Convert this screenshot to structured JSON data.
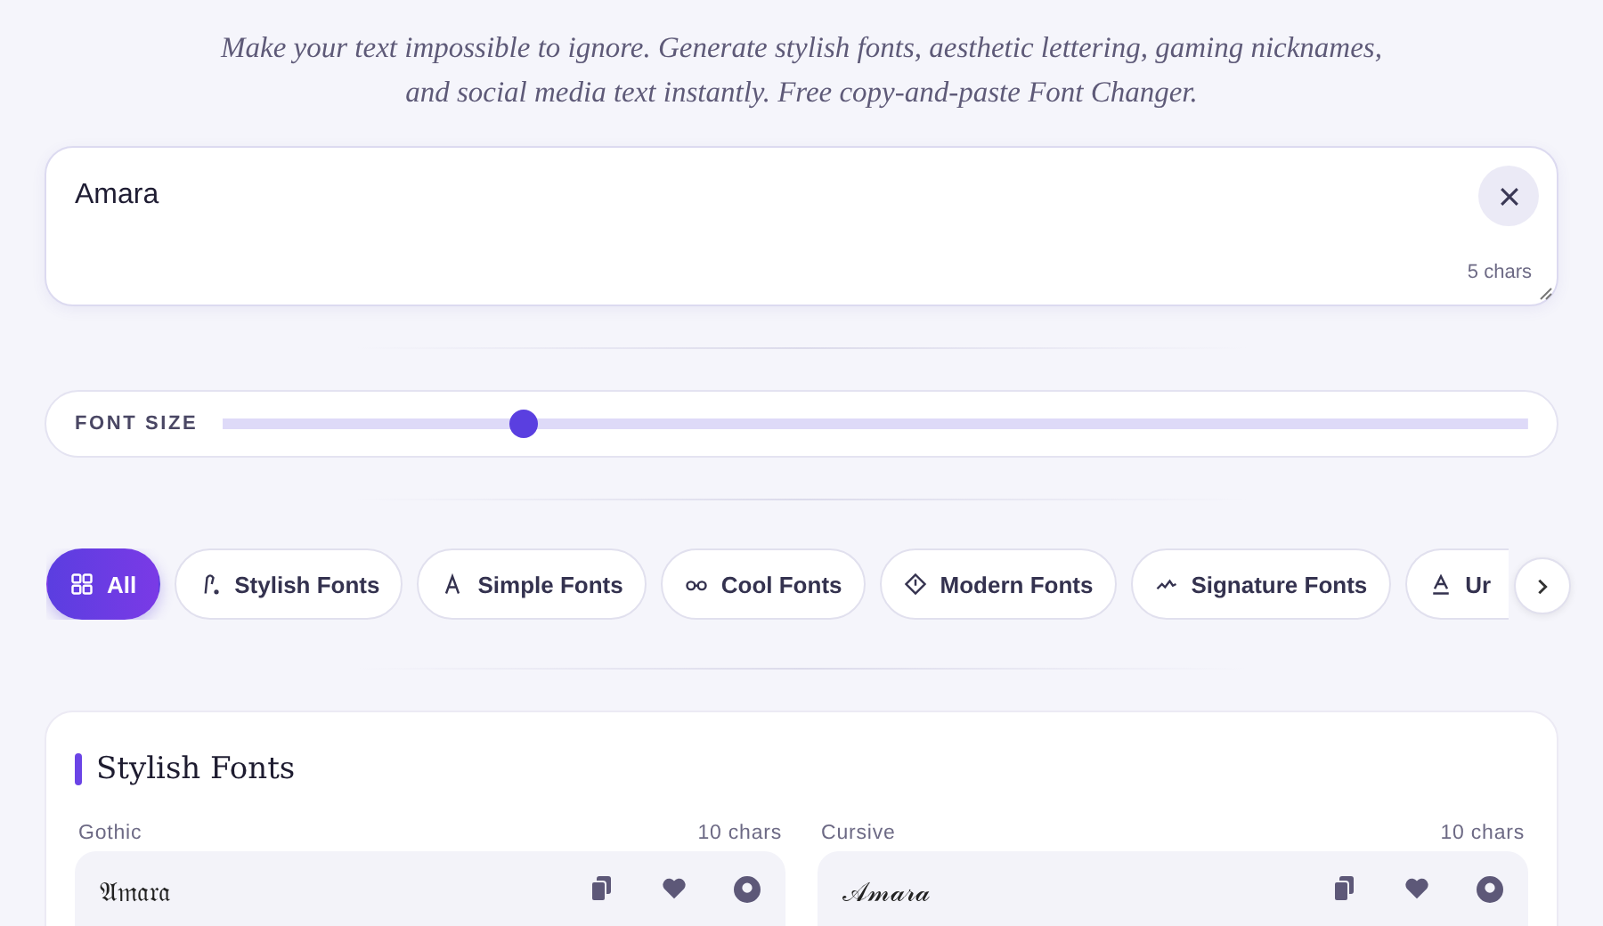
{
  "subtitle": "Make your text impossible to ignore. Generate stylish fonts, aesthetic lettering, gaming nicknames, and social media text instantly. Free copy-and-paste Font Changer.",
  "input": {
    "value": "Amara",
    "char_count": "5 chars"
  },
  "font_size": {
    "label": "FONT SIZE",
    "level": 0.23
  },
  "categories": [
    {
      "label": "All",
      "kind": "grid",
      "selected": true
    },
    {
      "label": "Stylish Fonts",
      "kind": "pen",
      "selected": false
    },
    {
      "label": "Simple Fonts",
      "kind": "letter",
      "selected": false
    },
    {
      "label": "Cool Fonts",
      "kind": "glasses",
      "selected": false
    },
    {
      "label": "Modern Fonts",
      "kind": "diamond",
      "selected": false
    },
    {
      "label": "Signature Fonts",
      "kind": "wave",
      "selected": false
    },
    {
      "label": "Ur",
      "kind": "underline",
      "selected": false
    }
  ],
  "section": {
    "title": "Stylish Fonts",
    "fonts": [
      {
        "name": "Gothic",
        "count": "10 chars",
        "sample": "𝔄𝔪𝔞𝔯𝔞"
      },
      {
        "name": "Cursive",
        "count": "10 chars",
        "sample": "𝒜𝓂𝒶𝓇𝒶"
      }
    ]
  }
}
